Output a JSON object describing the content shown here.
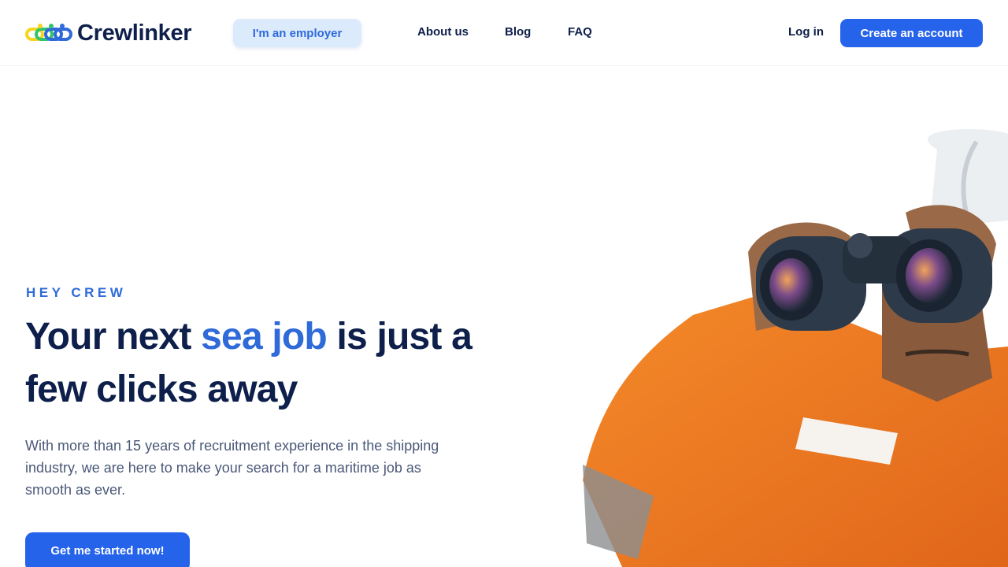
{
  "brand": {
    "name": "Crewlinker",
    "colors": {
      "primary": "#2563eb",
      "accent": "#2f6ad9",
      "navy": "#0d1f4a",
      "yellow": "#f6d51f",
      "green": "#32c46c"
    }
  },
  "nav": {
    "employer_label": "I'm an employer",
    "links": [
      {
        "label": "About us"
      },
      {
        "label": "Blog"
      },
      {
        "label": "FAQ"
      }
    ],
    "login_label": "Log in",
    "create_account_label": "Create an account"
  },
  "hero": {
    "eyebrow": "HEY CREW",
    "headline_before": "Your next ",
    "headline_accent": "sea job",
    "headline_after": " is just a few clicks away",
    "description": "With more than 15 years of recruitment experience in the shipping industry, we are here to make your search for a maritime job as smooth as ever.",
    "cta_label": "Get me started now!",
    "image": {
      "icon": "seafarer-with-binoculars-photo"
    }
  }
}
